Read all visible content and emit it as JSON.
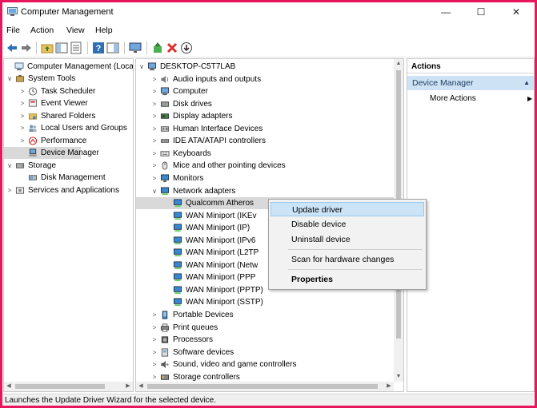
{
  "window": {
    "title": "Computer Management",
    "controls": {
      "minimize": "—",
      "maximize": "☐",
      "close": "✕"
    }
  },
  "menu": [
    "File",
    "Action",
    "View",
    "Help"
  ],
  "toolbar_icons": [
    "back-arrow-icon",
    "forward-arrow-icon",
    "up-folder-icon",
    "show-hide-console-tree-icon",
    "properties-icon",
    "help-icon",
    "show-action-pane-icon",
    "monitor-icon",
    "update-driver-icon",
    "uninstall-device-icon",
    "enable-device-icon"
  ],
  "left_tree": {
    "items": [
      {
        "label": "Computer Management (Local",
        "expander": "",
        "icon": "computer-management-icon"
      },
      {
        "label": "System Tools",
        "expander": "∨",
        "icon": "system-tools-icon"
      },
      {
        "label": "Task Scheduler",
        "expander": ">",
        "icon": "task-scheduler-icon"
      },
      {
        "label": "Event Viewer",
        "expander": ">",
        "icon": "event-viewer-icon"
      },
      {
        "label": "Shared Folders",
        "expander": ">",
        "icon": "shared-folders-icon"
      },
      {
        "label": "Local Users and Groups",
        "expander": ">",
        "icon": "local-users-icon"
      },
      {
        "label": "Performance",
        "expander": ">",
        "icon": "performance-icon"
      },
      {
        "label": "Device Manager",
        "expander": "",
        "icon": "device-manager-icon"
      },
      {
        "label": "Storage",
        "expander": "∨",
        "icon": "storage-icon"
      },
      {
        "label": "Disk Management",
        "expander": "",
        "icon": "disk-management-icon"
      },
      {
        "label": "Services and Applications",
        "expander": ">",
        "icon": "services-icon"
      }
    ]
  },
  "device_tree": {
    "items": [
      {
        "label": "DESKTOP-C5T7LAB",
        "expander": "∨",
        "icon": "computer-icon"
      },
      {
        "label": "Audio inputs and outputs",
        "expander": ">",
        "icon": "audio-icon"
      },
      {
        "label": "Computer",
        "expander": ">",
        "icon": "computer-icon"
      },
      {
        "label": "Disk drives",
        "expander": ">",
        "icon": "disk-drive-icon"
      },
      {
        "label": "Display adapters",
        "expander": ">",
        "icon": "display-adapter-icon"
      },
      {
        "label": "Human Interface Devices",
        "expander": ">",
        "icon": "hid-icon"
      },
      {
        "label": "IDE ATA/ATAPI controllers",
        "expander": ">",
        "icon": "ide-controller-icon"
      },
      {
        "label": "Keyboards",
        "expander": ">",
        "icon": "keyboard-icon"
      },
      {
        "label": "Mice and other pointing devices",
        "expander": ">",
        "icon": "mouse-icon"
      },
      {
        "label": "Monitors",
        "expander": ">",
        "icon": "monitor-icon"
      },
      {
        "label": "Network adapters",
        "expander": "∨",
        "icon": "network-adapter-icon"
      },
      {
        "label": "Qualcomm Atheros",
        "expander": "",
        "icon": "network-adapter-icon"
      },
      {
        "label": "WAN Miniport (IKEv",
        "expander": "",
        "icon": "network-adapter-icon"
      },
      {
        "label": "WAN Miniport (IP)",
        "expander": "",
        "icon": "network-adapter-icon"
      },
      {
        "label": "WAN Miniport (IPv6",
        "expander": "",
        "icon": "network-adapter-icon"
      },
      {
        "label": "WAN Miniport (L2TP",
        "expander": "",
        "icon": "network-adapter-icon"
      },
      {
        "label": "WAN Miniport (Netw",
        "expander": "",
        "icon": "network-adapter-icon"
      },
      {
        "label": "WAN Miniport (PPP",
        "expander": "",
        "icon": "network-adapter-icon"
      },
      {
        "label": "WAN Miniport (PPTP)",
        "expander": "",
        "icon": "network-adapter-icon"
      },
      {
        "label": "WAN Miniport (SSTP)",
        "expander": "",
        "icon": "network-adapter-icon"
      },
      {
        "label": "Portable Devices",
        "expander": ">",
        "icon": "portable-device-icon"
      },
      {
        "label": "Print queues",
        "expander": ">",
        "icon": "printer-icon"
      },
      {
        "label": "Processors",
        "expander": ">",
        "icon": "processor-icon"
      },
      {
        "label": "Software devices",
        "expander": ">",
        "icon": "software-device-icon"
      },
      {
        "label": "Sound, video and game controllers",
        "expander": ">",
        "icon": "sound-icon"
      },
      {
        "label": "Storage controllers",
        "expander": ">",
        "icon": "storage-controller-icon"
      }
    ]
  },
  "actions": {
    "header": "Actions",
    "section": "Device Manager",
    "more": "More Actions"
  },
  "context_menu": {
    "items": [
      "Update driver",
      "Disable device",
      "Uninstall device",
      "Scan for hardware changes",
      "Properties"
    ]
  },
  "status": "Launches the Update Driver Wizard for the selected device.",
  "colors": {
    "accent_border": "#e8175d",
    "selection": "#cce4f7",
    "actions_section": "#cde3f5"
  }
}
